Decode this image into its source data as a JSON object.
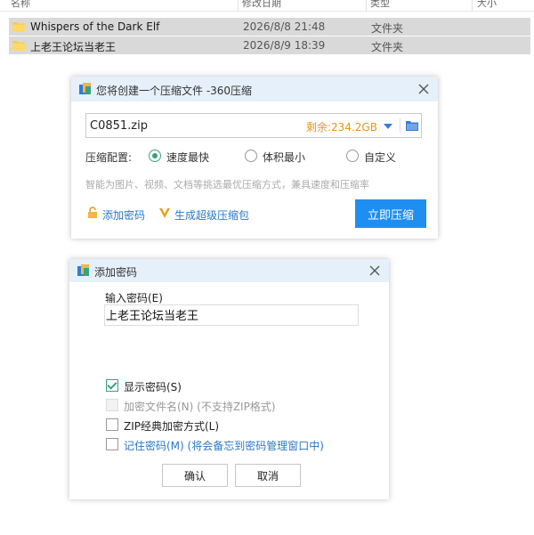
{
  "explorer": {
    "columns": [
      "名称",
      "修改日期",
      "类型",
      "大小"
    ],
    "files": [
      {
        "name": "Whispers of the Dark Elf",
        "date": "2026/8/8 21:48",
        "type": "文件夹"
      },
      {
        "name": "上老王论坛当老王",
        "date": "2026/8/9 18:39",
        "type": "文件夹"
      }
    ]
  },
  "compress_dialog": {
    "title": "您将创建一个压缩文件 -360压缩",
    "filename": "C0851.zip",
    "free_space": "剩余:234.2GB",
    "config_label": "压缩配置:",
    "options": [
      "速度最快",
      "体积最小",
      "自定义"
    ],
    "selected_option": "速度最快",
    "hint": "智能为图片、视频、文档等挑选最优压缩方式，兼具速度和压缩率",
    "add_password": "添加密码",
    "super_package": "生成超级压缩包",
    "compress_button": "立即压缩"
  },
  "password_dialog": {
    "title": "添加密码",
    "input_label": "输入密码(E)",
    "password_value": "上老王论坛当老王",
    "checkboxes": [
      {
        "label": "显示密码(S)",
        "checked": true,
        "enabled": true
      },
      {
        "label": "加密文件名(N) (不支持ZIP格式)",
        "checked": false,
        "enabled": false
      },
      {
        "label": "ZIP经典加密方式(L)",
        "checked": false,
        "enabled": true
      },
      {
        "label": "记住密码(M) (将会备忘到密码管理窗口中)",
        "checked": false,
        "enabled": true
      }
    ],
    "ok_button": "确认",
    "cancel_button": "取消"
  },
  "colors": {
    "accent": "#1f8ef1",
    "radio_check": "#3aa17e",
    "free_space": "#e8951d",
    "link": "#2a78c8",
    "row_selected": "#d9d9d9",
    "titlebar": "#e6f0fb"
  }
}
